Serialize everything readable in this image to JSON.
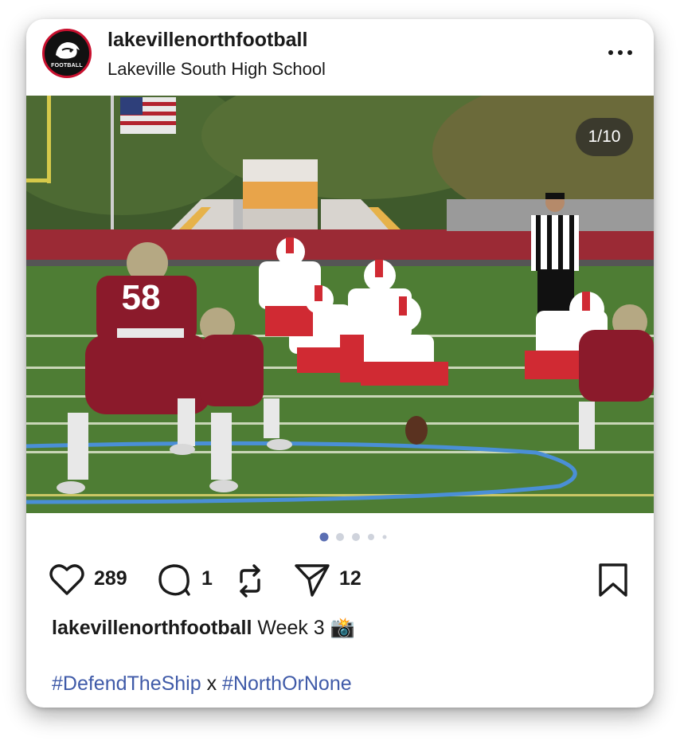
{
  "post": {
    "username": "lakevillenorthfootball",
    "location": "Lakeville South High School",
    "avatar_text": "FOOTBALL",
    "more_icon": "more-horizontal-icon",
    "photo": {
      "counter": "1/10",
      "jersey_number": "58",
      "slide_index": 1,
      "slide_dots_visible": 5
    },
    "actions": {
      "likes": "289",
      "comments": "1",
      "shares": "12",
      "icons": [
        "heart-icon",
        "comment-icon",
        "repost-icon",
        "send-icon",
        "bookmark-icon"
      ]
    },
    "caption": {
      "username": "lakevillenorthfootball",
      "text": "Week 3 📸"
    },
    "hashtags": {
      "tag1": "#DefendTheShip",
      "separator": "x",
      "tag2": "#NorthOrNone"
    },
    "colors": {
      "hashtag": "#3f5aa8",
      "active_dot": "#5b6fb3",
      "inactive_dot": "#cfd3dc",
      "home_jersey": "#8b1a2b",
      "away_jersey": "#ffffff"
    }
  }
}
